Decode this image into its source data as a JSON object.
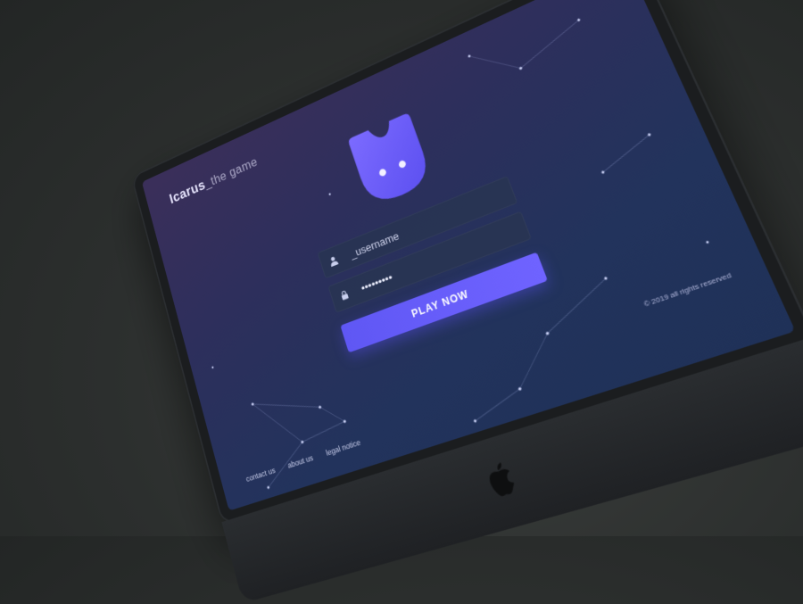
{
  "brand": {
    "name": "Icarus",
    "tagline": "_the game"
  },
  "login": {
    "username_placeholder": "_username",
    "password_value": "•••••••••",
    "play_label": "PLAY NOW",
    "user_icon": "user-icon",
    "lock_icon": "lock-icon"
  },
  "footer": {
    "links": [
      "contact us",
      "about us",
      "legal notice"
    ],
    "copyright": "© 2019 all rights reserved"
  },
  "colors": {
    "accent": "#6a5ff9",
    "screen_top": "#3b2f5a",
    "screen_bottom": "#1f3158",
    "mascot": "#6a5ff9"
  },
  "icons": [
    "apple-logo-icon",
    "mascot-icon"
  ]
}
